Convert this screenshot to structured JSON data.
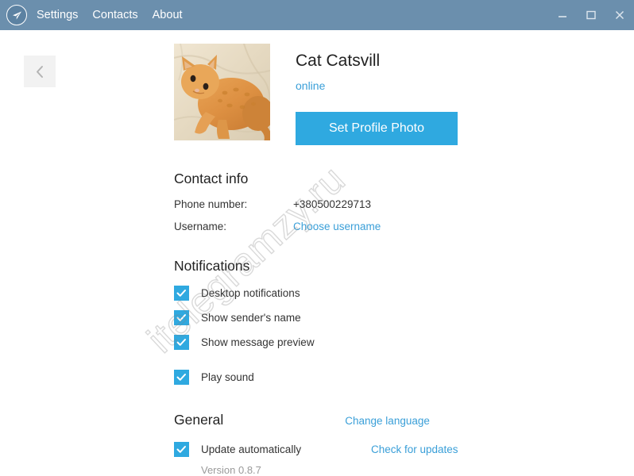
{
  "window": {
    "app_icon": "paper-plane-icon",
    "menu": [
      {
        "label": "Settings"
      },
      {
        "label": "Contacts"
      },
      {
        "label": "About"
      }
    ],
    "controls": {
      "minimize": "minimize-icon",
      "maximize": "maximize-icon",
      "close": "close-icon"
    },
    "titlebar_color": "#6b8fad"
  },
  "watermark": {
    "text": "itelegramzy.ru"
  },
  "navigation": {
    "back_icon": "chevron-left-icon"
  },
  "profile": {
    "avatar_alt": "orange-tabby-cat-photo",
    "name": "Cat Catsvill",
    "status": "online",
    "set_photo_button": "Set Profile Photo"
  },
  "contact_info": {
    "title": "Contact info",
    "rows": [
      {
        "label": "Phone number:",
        "value": "+380500229713",
        "is_link": false
      },
      {
        "label": "Username:",
        "value": "Choose username",
        "is_link": true
      }
    ]
  },
  "notifications": {
    "title": "Notifications",
    "options": [
      {
        "label": "Desktop notifications",
        "checked": true
      },
      {
        "label": "Show sender's name",
        "checked": true
      },
      {
        "label": "Show message preview",
        "checked": true
      }
    ],
    "sound": {
      "label": "Play sound",
      "checked": true
    }
  },
  "general": {
    "title": "General",
    "change_language_link": "Change language",
    "update_option": {
      "label": "Update automatically",
      "checked": true
    },
    "check_updates_link": "Check for updates",
    "version": "Version 0.8.7"
  },
  "colors": {
    "accent": "#2fa9e0",
    "link": "#3a9fd8",
    "titlebar": "#6b8fad",
    "muted": "#9a9a9a"
  }
}
